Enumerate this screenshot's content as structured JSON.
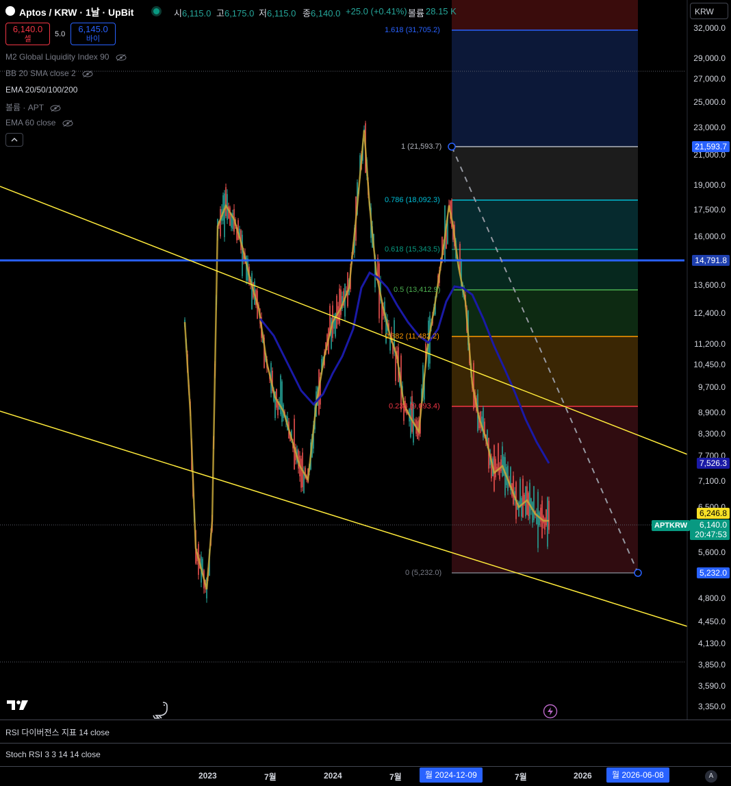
{
  "header": {
    "symbol_title": "Aptos / KRW · 1날 · UpBit",
    "ohlc": [
      {
        "k": "시",
        "v": "6,115.0"
      },
      {
        "k": "고",
        "v": "6,175.0"
      },
      {
        "k": "저",
        "v": "6,115.0"
      },
      {
        "k": "종",
        "v": "6,140.0"
      }
    ],
    "change": "+25.0 (+0.41%)",
    "volume_label": "볼륨",
    "volume_value": "28.15 K",
    "currency_select": "KRW"
  },
  "trade": {
    "sell_price": "6,140.0",
    "sell_label": "셀",
    "spread": "5.0",
    "buy_price": "6,145.0",
    "buy_label": "바이"
  },
  "indicators": [
    {
      "label": "M2 Global Liquidity Index 90",
      "hidden": true
    },
    {
      "label": "BB 20 SMA close 2",
      "hidden": true
    },
    {
      "label": "EMA 20/50/100/200",
      "hidden": false
    },
    {
      "label": "볼륨 · APT",
      "hidden": true
    },
    {
      "label": "EMA 60 close",
      "hidden": true
    }
  ],
  "price_axis": [
    "32,000.0",
    "29,000.0",
    "27,000.0",
    "25,000.0",
    "23,000.0",
    "21,000.0",
    "19,000.0",
    "17,500.0",
    "16,000.0",
    "14,791.8",
    "13,600.0",
    "12,400.0",
    "11,200.0",
    "10,450.0",
    "9,700.0",
    "8,900.0",
    "8,300.0",
    "7,700.0",
    "7,100.0",
    "6,500.0",
    "5,600.0",
    "4,800.0",
    "4,450.0",
    "4,130.0",
    "3,850.0",
    "3,590.0",
    "3,350.0"
  ],
  "price_tags": {
    "fib_high": "21,593.7",
    "hline": "14,791.8",
    "ema": "7,526.3",
    "prev": "6,246.8",
    "last": "6,140.0",
    "countdown": "20:47:53",
    "fib_low": "5,232.0",
    "symbol_badge": "APTKRW"
  },
  "fib_levels": [
    {
      "label": "1.618 (31,705.2)",
      "color": "#2962ff"
    },
    {
      "label": "1 (21,593.7)",
      "color": "#b2b5be"
    },
    {
      "label": "0.786 (18,092.3)",
      "color": "#00bcd4"
    },
    {
      "label": "0.618 (15,343.5)",
      "color": "#089981"
    },
    {
      "label": "0.5 (13,412.9)",
      "color": "#4caf50"
    },
    {
      "label": "0.382 (11,482.2)",
      "color": "#ff9800"
    },
    {
      "label": "0.236 (9,093.4)",
      "color": "#f23645"
    },
    {
      "label": "0 (5,232.0)",
      "color": "#787b86"
    }
  ],
  "panes": {
    "rsi": "RSI 다이버전스 지표 14 close",
    "stoch": "Stoch RSI 3 3 14 14 close"
  },
  "time_axis": {
    "ticks": [
      "2023",
      "7월",
      "2024",
      "7월",
      "7월",
      "2026"
    ],
    "start_date": "월 2024-12-09",
    "end_date": "월 2026-06-08",
    "auto": "A"
  },
  "colors": {
    "up": "#26a69a",
    "down": "#ef5350",
    "trendline": "#ffeb3b",
    "hline": "#2962ff",
    "ema200": "#1a1aa6",
    "accent": "#2962ff"
  },
  "icons": [
    "tradingview-logo-icon",
    "dino-icon",
    "lightning-icon",
    "eye-off-icon",
    "chevron-up-icon"
  ]
}
